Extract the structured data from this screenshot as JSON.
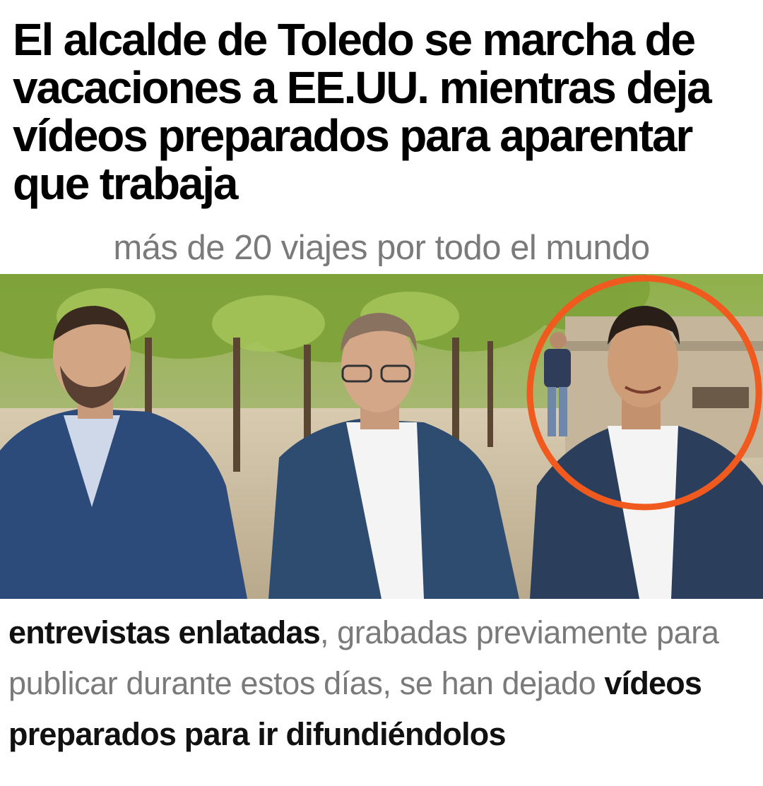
{
  "headline": "El alcalde de Toledo se marcha de vacaciones a EE.UU. mientras deja vídeos preparados para aparentar que trabaja",
  "subheadline": "más de 20 viajes por todo el mundo",
  "photo": {
    "highlight_color": "#f05a1e"
  },
  "caption": {
    "part1_bold": "entrevistas enlatadas",
    "part2": ", grabadas previamente para publicar durante estos días, se han dejado ",
    "part3_bold": "vídeos preparados para ir difundiéndolos"
  }
}
